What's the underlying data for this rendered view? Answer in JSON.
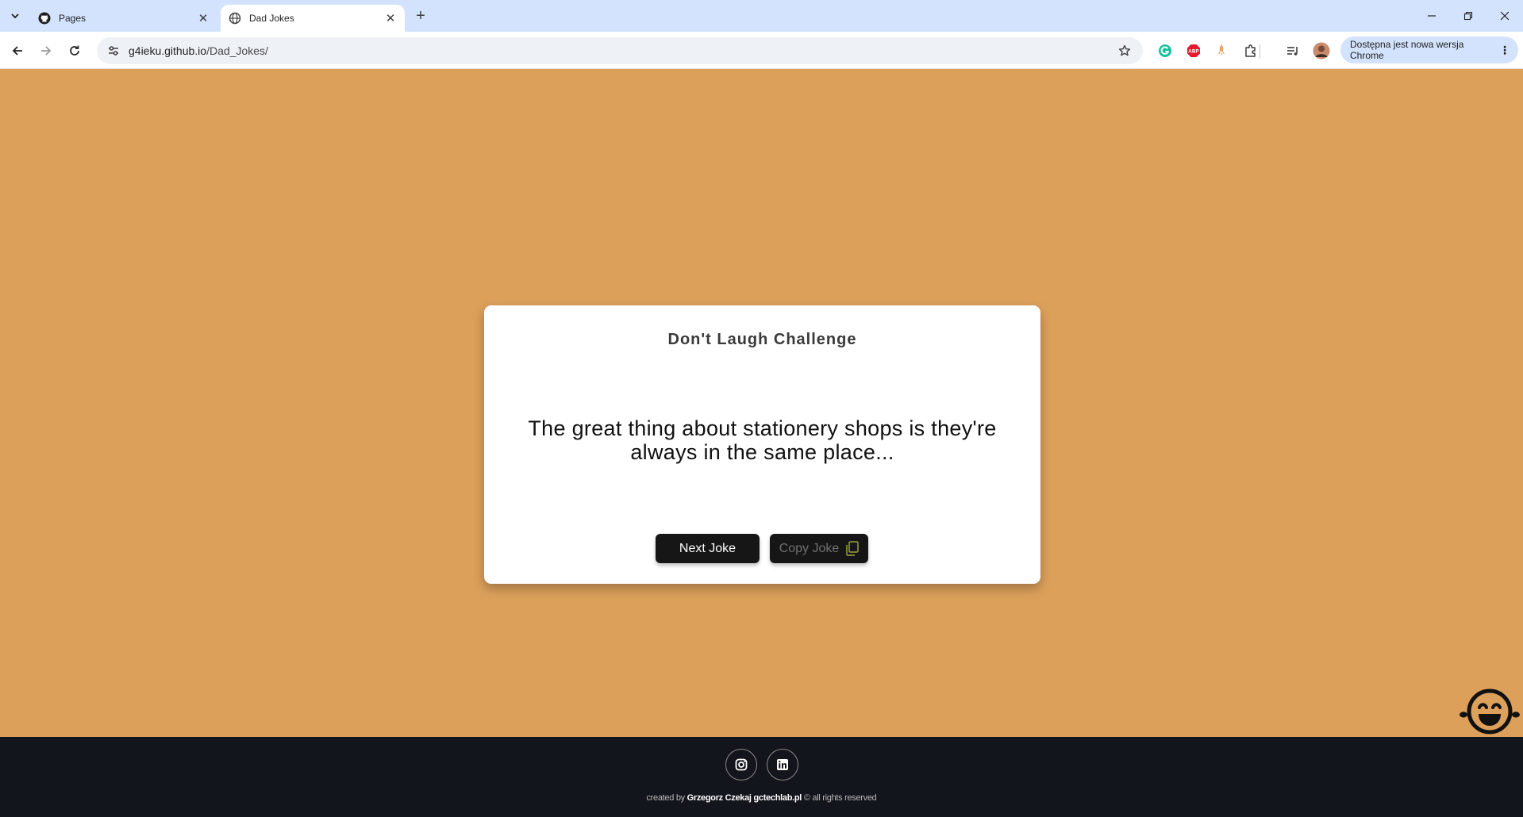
{
  "browser": {
    "tabs": [
      {
        "title": "Pages",
        "icon": "github-icon",
        "active": false
      },
      {
        "title": "Dad Jokes",
        "icon": "globe-icon",
        "active": true
      }
    ],
    "url_host": "g4ieku.github.io",
    "url_path": "/Dad_Jokes/",
    "update_label": "Dostępna jest nowa wersja Chrome",
    "extensions": [
      "grammarly-icon",
      "adblock-icon",
      "rocket-icon",
      "puzzle-icon",
      "media-icon",
      "profile-avatar"
    ]
  },
  "card": {
    "title": "Don't Laugh Challenge",
    "joke": "The great thing about stationery shops is they're always in the same place...",
    "next_label": "Next Joke",
    "copy_label": "Copy Joke"
  },
  "footer": {
    "created_by": "created by",
    "author": "Grzegorz Czekaj",
    "site": "gctechlab.pl",
    "rights": "© all rights reserved",
    "socials": [
      "instagram-icon",
      "linkedin-icon"
    ]
  },
  "colors": {
    "page_background": "#dca05b",
    "card_background": "#ffffff",
    "button_background": "#161616",
    "footer_background": "#13151c",
    "chrome_tabbar": "#d3e3fd"
  }
}
